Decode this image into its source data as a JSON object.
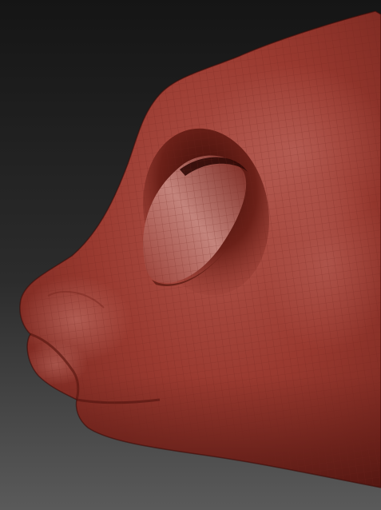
{
  "scene": {
    "subject": "sculpt-mesh-head-profile",
    "colors": {
      "background_top": "#151515",
      "background_bottom": "#5a5a5a",
      "clay_base": "#9a3a30",
      "clay_highlight": "#c27068",
      "clay_shadow": "#4f130e",
      "wire": "#6f241d"
    }
  }
}
